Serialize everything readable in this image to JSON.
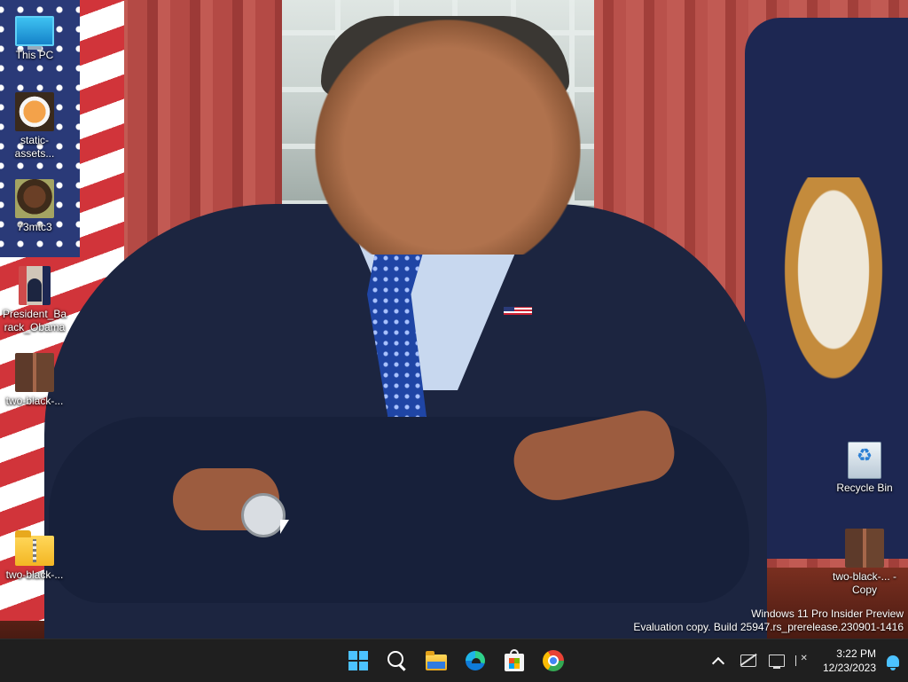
{
  "desktop": {
    "icons_left": [
      {
        "label": "This PC",
        "icon": "this-pc-icon"
      },
      {
        "label": "static-assets...",
        "icon": "image-thumbnail-icon"
      },
      {
        "label": "73mtc3",
        "icon": "image-thumbnail-icon"
      },
      {
        "label": "President_Barack_Obama",
        "icon": "image-thumbnail-icon"
      },
      {
        "label": "two-black-...",
        "icon": "image-thumbnail-icon"
      },
      {
        "label": "two-black-...",
        "icon": "zip-folder-icon"
      }
    ],
    "icons_right": [
      {
        "label": "Recycle Bin",
        "icon": "recycle-bin-icon"
      },
      {
        "label": "two-black-... - Copy",
        "icon": "image-thumbnail-icon"
      }
    ],
    "watermark": {
      "line1": "Windows 11 Pro Insider Preview",
      "line2": "Evaluation copy. Build 25947.rs_prerelease.230901-1416"
    }
  },
  "taskbar": {
    "apps": [
      "start-icon",
      "search-icon",
      "file-explorer-icon",
      "edge-icon",
      "microsoft-store-icon",
      "chrome-icon"
    ],
    "clock": {
      "time": "3:22 PM",
      "date": "12/23/2023"
    },
    "tray": [
      "show-hidden-icons-chevron",
      "network-icon",
      "display-icon",
      "volume-muted-icon",
      "notifications-bell-icon"
    ]
  }
}
